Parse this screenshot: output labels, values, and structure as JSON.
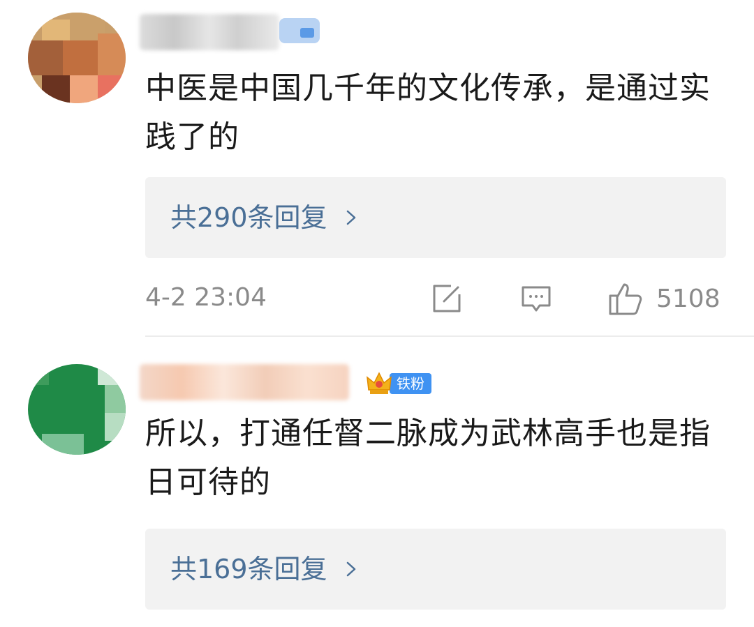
{
  "comments": [
    {
      "content": "中医是中国几千年的文化传承，是通过实践了的",
      "reply_count_label": "共290条回复",
      "timestamp": "4-2 23:04",
      "like_count": "5108"
    },
    {
      "badge_label": "铁粉",
      "content": "所以，打通任督二脉成为武林高手也是指日可待的",
      "reply_count_label": "共169条回复"
    }
  ],
  "colors": {
    "reply_link": "#4a6f96",
    "meta_gray": "#8a8a8a",
    "reply_box_bg": "#f2f2f2",
    "fan_badge_bg": "#3f92f2"
  },
  "icons": {
    "share": "share-icon",
    "comment": "comment-icon",
    "like": "thumbs-up-icon",
    "chevron": "chevron-right-icon",
    "crown": "crown-icon"
  }
}
